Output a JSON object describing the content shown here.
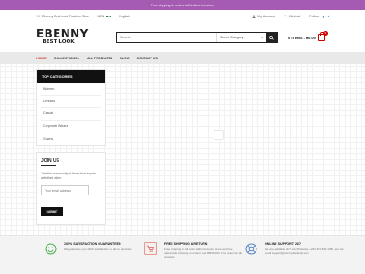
{
  "promo": {
    "text": "Free shipping for orders within Accentra store"
  },
  "topbar": {
    "store": "Ebenny Best Look Fashion Store",
    "currency": "MZN",
    "language": "English",
    "account": "My Account",
    "wishlist": "Wishlist",
    "follow": "Follow:"
  },
  "logo": {
    "main": "EBENNY",
    "sub": "BEST LOOK"
  },
  "search": {
    "placeholder": "Search",
    "category": "Select Category"
  },
  "cart": {
    "label": "0 ITEMS - ₦0.00",
    "count": "0"
  },
  "nav": {
    "items": [
      {
        "label": "HOME"
      },
      {
        "label": "COLLECTIONS"
      },
      {
        "label": "ALL PRODUCTS"
      },
      {
        "label": "BLOG"
      },
      {
        "label": "CONTACT US"
      }
    ]
  },
  "sidebar": {
    "title": "TOP CATEGORIES",
    "items": [
      "Women",
      "Dresses",
      "Casual",
      "Corporate Wears",
      "Gowns"
    ]
  },
  "join": {
    "title": "JOIN US",
    "text": "Join the community of those that inspire with their attire.",
    "placeholder": "Your email address",
    "button": "SUBMIT"
  },
  "features": [
    {
      "title": "100% SATISFACTION GUARANTEED",
      "desc": "We guarantee you 100% satisfaction on all our products"
    },
    {
      "title": "FREE SHIPPING & RETURN",
      "desc": "Free shipping on all order within Accentra store and free nationwide shipping on orders over ₦250,000. Free return on all products"
    },
    {
      "title": "ONLINE SUPPORT 24/7",
      "desc": "We are available 24/7 via WhatsApp +234 904 832 1295, and via email support@ebennybestlook.com"
    }
  ],
  "colors": {
    "promo": "#a45bb1",
    "accent": "#d12a2a",
    "dark": "#111111",
    "feature_green": "#4caf50",
    "feature_red": "#e06b5a",
    "feature_blue": "#5a86c5"
  }
}
